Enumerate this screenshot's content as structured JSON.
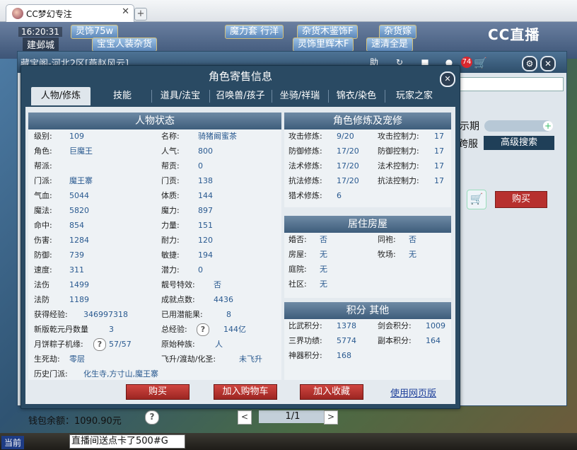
{
  "browser": {
    "tab_title": "CC梦幻专注",
    "tab_close": "✕",
    "new_tab": "+"
  },
  "game": {
    "clock": "16:20:31",
    "city": "建邺城",
    "top_chips": [
      "灵饰75w",
      "魔力套 行洋",
      "杂货木鉴饰F",
      "杂货嫁",
      "宝宝人装杂货",
      "灵饰里辉木F",
      "速清全是"
    ],
    "cc_logo": "CC直播"
  },
  "back_window": {
    "title": "藏宝阁-河北2区[燕赵风云]",
    "header_icons": [
      "助",
      "↻",
      "■",
      "●"
    ],
    "badge": "74",
    "show_date_label": "示期",
    "cross_server": "跨服",
    "advanced_search": "高级搜索",
    "buy": "购买",
    "wallet": "钱包余额：1090.90元",
    "wallet_help": "?",
    "page": "1/1",
    "prev": "<",
    "next": ">"
  },
  "bottom": {
    "current": "当前",
    "chat": "直播间送点卡了500#G"
  },
  "dialog": {
    "title": "角色寄售信息",
    "tabs": [
      "人物/修炼",
      "技能",
      "道具/法宝",
      "召唤兽/孩子",
      "坐骑/祥瑞",
      "锦衣/染色",
      "玩家之家"
    ],
    "status_title": "人物状态",
    "status_left": [
      {
        "k": "级别:",
        "v": "109"
      },
      {
        "k": "角色:",
        "v": "巨魔王"
      },
      {
        "k": "帮派:",
        "v": ""
      },
      {
        "k": "门派:",
        "v": "魔王寨"
      },
      {
        "k": "气血:",
        "v": "5044"
      },
      {
        "k": "魔法:",
        "v": "5820"
      },
      {
        "k": "命中:",
        "v": "854"
      },
      {
        "k": "伤害:",
        "v": "1284"
      },
      {
        "k": "防御:",
        "v": "739"
      },
      {
        "k": "速度:",
        "v": "311"
      },
      {
        "k": "法伤",
        "v": "1499"
      },
      {
        "k": "法防",
        "v": "1189"
      }
    ],
    "status_right": [
      {
        "k": "名称:",
        "v": "骑猪阚蜜茶"
      },
      {
        "k": "人气:",
        "v": "800"
      },
      {
        "k": "帮贡:",
        "v": "0"
      },
      {
        "k": "门贡:",
        "v": "138"
      },
      {
        "k": "体质:",
        "v": "144"
      },
      {
        "k": "魔力:",
        "v": "897"
      },
      {
        "k": "力量:",
        "v": "151"
      },
      {
        "k": "耐力:",
        "v": "120"
      },
      {
        "k": "敏捷:",
        "v": "194"
      },
      {
        "k": "潜力:",
        "v": "0"
      },
      {
        "k": "靓号特效:",
        "v": "否"
      },
      {
        "k": "成就点数:",
        "v": "4436"
      }
    ],
    "extra": {
      "exp_k": "获得经验:",
      "exp_v": "346997318",
      "used_k": "已用潜能果:",
      "used_v": "8",
      "qy_k": "新版乾元丹数量",
      "qy_v": "3",
      "total_k": "总经验:",
      "total_q": "?",
      "total_v": "144亿",
      "yb_k": "月饼粽子机缘:",
      "yb_q": "?",
      "yb_v": "57/57",
      "race_k": "原始种族:",
      "race_v": "人",
      "sj_k": "生死劫:",
      "sj_v": "零层",
      "fs_k": "飞升/渡劫/化圣:",
      "fs_v": "未飞升",
      "hist_k": "历史门派:",
      "hist_v": "化生寺,方寸山,魔王寨"
    },
    "cultivation_title": "角色修炼及宠修",
    "cultivation": [
      {
        "k": "攻击修炼:",
        "v": "9/20",
        "k2": "攻击控制力:",
        "v2": "17"
      },
      {
        "k": "防御修炼:",
        "v": "17/20",
        "k2": "防御控制力:",
        "v2": "17"
      },
      {
        "k": "法术修炼:",
        "v": "17/20",
        "k2": "法术控制力:",
        "v2": "17"
      },
      {
        "k": "抗法修炼:",
        "v": "17/20",
        "k2": "抗法控制力:",
        "v2": "17"
      },
      {
        "k": "猎术修炼:",
        "v": "6",
        "k2": "",
        "v2": ""
      }
    ],
    "home_title": "居住房屋",
    "home": [
      {
        "k": "婚否:",
        "v": "否",
        "k2": "同袍:",
        "v2": "否"
      },
      {
        "k": "房屋:",
        "v": "无",
        "k2": "牧场:",
        "v2": "无"
      },
      {
        "k": "庭院:",
        "v": "无",
        "k2": "",
        "v2": ""
      },
      {
        "k": "社区:",
        "v": "无",
        "k2": "",
        "v2": ""
      }
    ],
    "score_title": "积分 其他",
    "score": [
      {
        "k": "比武积分:",
        "v": "1378",
        "k2": "剑会积分:",
        "v2": "1009"
      },
      {
        "k": "三界功绩:",
        "v": "5774",
        "k2": "副本积分:",
        "v2": "164"
      },
      {
        "k": "神器积分:",
        "v": "168",
        "k2": "",
        "v2": ""
      }
    ],
    "buttons": {
      "buy": "购买",
      "add_cart": "加入购物车",
      "add_fav": "加入收藏",
      "web": "使用网页版"
    },
    "close": "✕"
  },
  "colors": {
    "accent": "#2a4a63",
    "buy_red": "#b7302e",
    "value_blue": "#2a5a90"
  }
}
